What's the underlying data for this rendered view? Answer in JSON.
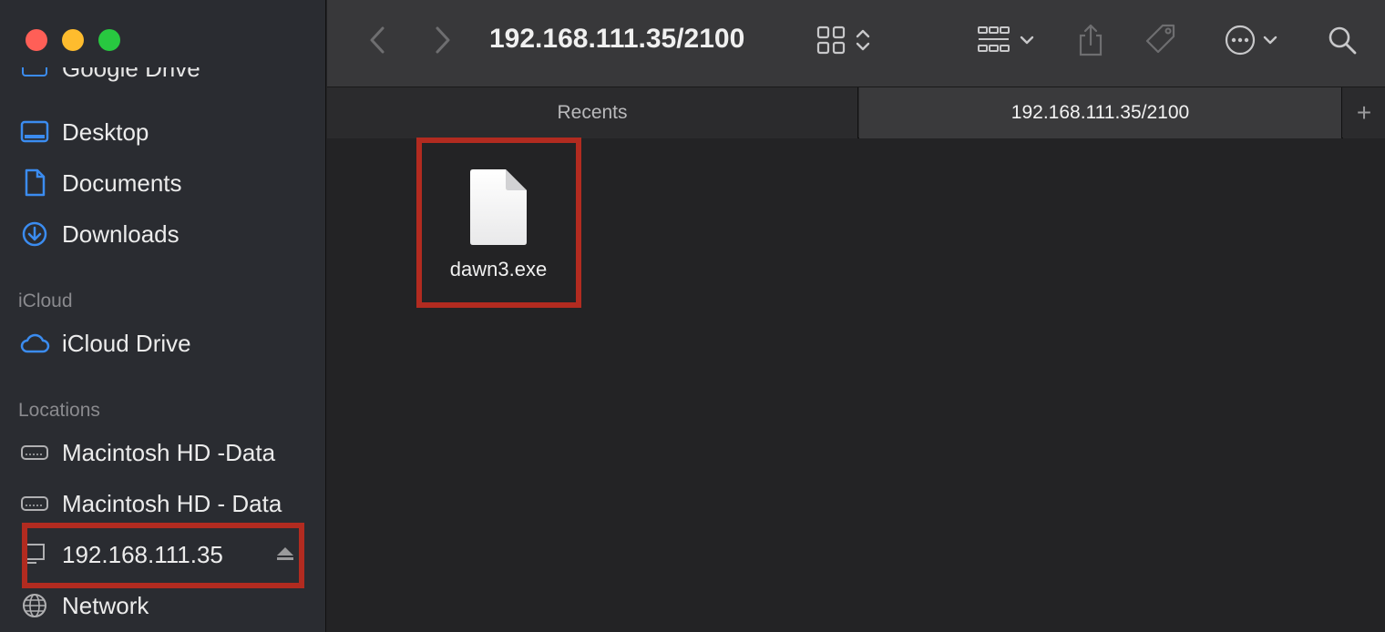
{
  "window": {
    "title": "192.168.111.35/2100"
  },
  "sidebar": {
    "partial_item": "Google Drive",
    "favorites": [
      {
        "label": "Desktop",
        "icon": "desktop-icon"
      },
      {
        "label": "Documents",
        "icon": "document-icon"
      },
      {
        "label": "Downloads",
        "icon": "downloads-icon"
      }
    ],
    "icloud_header": "iCloud",
    "icloud_items": [
      {
        "label": "iCloud Drive",
        "icon": "cloud-icon"
      }
    ],
    "locations_header": "Locations",
    "locations": [
      {
        "label": "Macintosh HD -Data",
        "icon": "drive-icon"
      },
      {
        "label": "Macintosh HD - Data",
        "icon": "drive-icon"
      },
      {
        "label": "192.168.111.35",
        "icon": "server-icon"
      },
      {
        "label": "Network",
        "icon": "globe-icon"
      }
    ]
  },
  "tabs": [
    {
      "label": "Recents"
    },
    {
      "label": "192.168.111.35/2100"
    }
  ],
  "tab_add_label": "+",
  "files": [
    {
      "name": "dawn3.exe",
      "icon": "file-icon"
    }
  ],
  "colors": {
    "highlight": "#b22b20",
    "accent": "#3b8cf0"
  }
}
